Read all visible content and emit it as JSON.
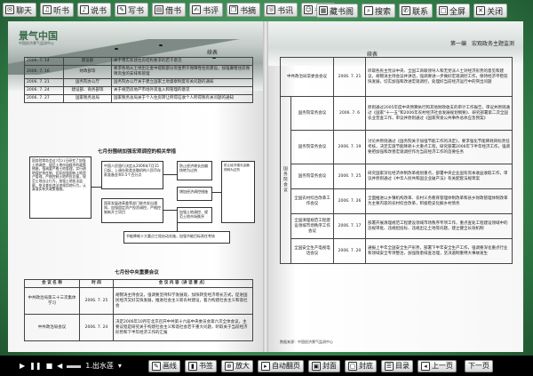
{
  "toolbar_left": [
    {
      "label": "聊天",
      "icon": "chat-icon"
    },
    {
      "label": "听书",
      "icon": "headphones-icon"
    },
    {
      "label": "说书",
      "icon": "speak-icon"
    },
    {
      "label": "写书",
      "icon": "write-icon"
    },
    {
      "label": "借书",
      "icon": "borrow-icon"
    },
    {
      "label": "书评",
      "icon": "review-icon"
    },
    {
      "label": "书摘",
      "icon": "excerpt-icon"
    },
    {
      "label": "书讯",
      "icon": "news-icon"
    },
    {
      "label": "书友",
      "icon": "friends-icon"
    }
  ],
  "toolbar_right": [
    {
      "label": "藏书阁",
      "icon": "library-icon"
    },
    {
      "label": "搜索",
      "icon": "search-icon"
    },
    {
      "label": "联系",
      "icon": "contact-icon"
    },
    {
      "label": "全屏",
      "icon": "fullscreen-icon"
    },
    {
      "label": "关闭",
      "icon": "close-icon"
    }
  ],
  "left_page": {
    "logo": "景气中国",
    "logo_sub": "中国经济景气监测中心",
    "continued": "续表",
    "top_table": [
      [
        "2006. 7. 14",
        "建设部",
        "关于落实新建住房结构要求的若干意见"
      ],
      [
        "2006. 7. 16",
        "财政部等",
        "要求各地从土地出让金中提取部分资金用于保障性住房建设，加强廉租住房保障资金的安排和管理"
      ],
      [
        "2006. 7. 21",
        "国务院办公厅",
        "国务院办公厅关于建立国家土地督察制度有关问题的通知"
      ],
      [
        "2006. 7. 24",
        "建设部、商务部等",
        "关于规范房地产市场外资准入和管理的意见"
      ],
      [
        "2006. 7. 27",
        "国家税务总局",
        "国家税务总局关于个人住房转让所得征收个人所得税有关问题的通知"
      ]
    ],
    "flow_title": "七月份围绕加强宏观调控的相关举措",
    "flow_left": "国务院常务会议7月21日研究了加强土地调控、规范土地市场秩序的政策措施，强调要严格土地管理，实行耕地保护责任制，切实加强国有土地资产管理，严格控制土地供应总量，规范土地出让行为，加强土地执法监察，依法查处违法违规用地行为，认真落实有关政策措施。",
    "flow_mid_top": "中国人民银行决定从2006年7月15日起，上调存款类金融机构人民币存款准备金率0.5个百分点",
    "flow_mid_bottom": "国家发展改革委等部门联合发出通知，加强固定资产投资调控，严格控制新开工项目",
    "flow_right_top": "防止经济增长由偏快转为过热",
    "flow_right_mid": "增加经济调控措施",
    "flow_right_bottom": "加强土地调控、规范土地市场秩序",
    "flow_bottom": "节能降耗十大重点工程启动实施，加强节能目标责任考核",
    "meeting_title": "七月份中央重要会议",
    "meeting_headers": [
      "会 议 名 称",
      "时 间",
      "会 议 内 容（讲 话 要 点）"
    ],
    "meeting_rows": [
      [
        "中共政治局第三十三次集体学习",
        "2006. 7. 25",
        "胡锦涛主持会议，强调要坚持科学发展观，加快转变经济增长方式，促进国民经济又好又快发展，推进社会主义新农村建设，着力构建社会主义和谐社会"
      ],
      [
        "中共政治局会议",
        "2006. 7. 24",
        "决定2006年10月在北京召开中共第十六届中央委员会第六次全体会议，主要议程是研究关于构建社会主义和谐社会若干重大问题，听取关于当前经济形势和下半年经济工作的汇报"
      ]
    ]
  },
  "right_page": {
    "continued": "续表",
    "chapter": "第一编　宏观政务主题监测",
    "top_row": {
      "name": "中共政治局常委会会议",
      "date": "2006. 7. 21",
      "content": "听取各民主党派中央、全国工商联领导人和无党派人士对经济形势的意见和建议，胡锦涛主持会议并讲话，强调要进一步做好宏观调控工作，保持经济平稳较快发展，切实加强和改进宏观调控，处理好当前经济运行中的突出问题"
    },
    "group_label": "国务院会议",
    "rows": [
      {
        "name": "国务院常务会议",
        "date": "2006. 7. 6",
        "content": "原则通过2005年度中央预算执行和其他财政收支的审计工作报告，审议并原则通过《国家“十一五”和2006年农村经济社会发展规划纲要》、研究部署第二次全国农业普查工作，审议并原则通过《国家突发公共事件总体应急预案》"
      },
      {
        "name": "国务院常务会议",
        "date": "2006. 7. 19",
        "content": "讨论并原则通过《国务院关于加强节能工作的决定》，要求强化节能降耗目标责任考核，决定实施节能降耗十大重点工程，研究部署2006年下半年经济工作，强调要把加强和改善宏观调控作为当前经济工作的首要任务"
      },
      {
        "name": "国务院常务会议",
        "date": "2006. 7. 25",
        "content": "研究国家深化经济体制改革规划重点，部署中央企业国有资本收益收取工作，审议并原则通过《中华人民共和国企业破产法》有关配套法规草案"
      },
      {
        "name": "全国农村综合改革工作会议",
        "date": "2006. 7. 26",
        "content": "全面推进以乡镇机构改革、农村义务教育管理体制改革和县乡财政管理体制改革为主要内容的农村综合改革，积极稳妥化解乡村债务"
      },
      {
        "name": "全国清理规范工程建设领域市场秩序工作会议",
        "date": "2006. 7. 17",
        "content": "部署开展清理规范工程建设领域市场秩序专项工作，重点查处工程建设领域中的违规审批、违规招投标、违规出让土地等问题，建立健全长效机制"
      },
      {
        "name": "全国安全生产电视电话会议",
        "date": "2006. 7. 20",
        "content": "通报上半年全国安全生产形势，部署下半年安全生产工作，强调要深化重点行业和领域安全专项整治，加强隐患排查治理，坚决遏制重特大事故发生"
      }
    ],
    "footnote": "数据来源：中国经济景气监测中心"
  },
  "bottom_bar": {
    "language": "1.出水莲",
    "buttons": [
      {
        "label": "画线",
        "icon": "pen-icon"
      },
      {
        "label": "书签",
        "icon": "bookmark-icon"
      },
      {
        "label": "放大",
        "icon": "zoom-in-icon"
      },
      {
        "label": "自动翻页",
        "icon": "auto-flip-icon"
      },
      {
        "label": "封面",
        "icon": "cover-icon"
      },
      {
        "label": "封底",
        "icon": "back-cover-icon"
      },
      {
        "label": "目录",
        "icon": "toc-icon"
      },
      {
        "label": "上一页",
        "icon": "prev-icon"
      }
    ],
    "next": "下一页"
  }
}
